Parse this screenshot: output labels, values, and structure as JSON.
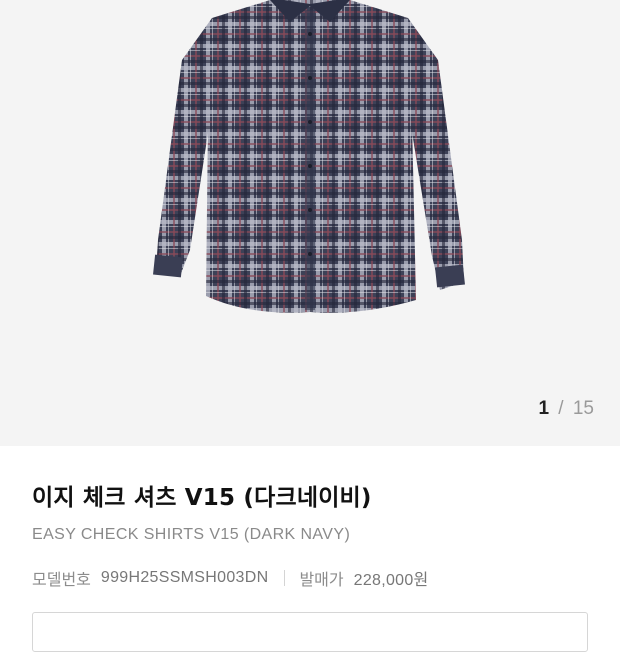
{
  "gallery": {
    "image_alt": "plaid check shirt dark navy",
    "colors": {
      "base": "#3b3f55",
      "check_light": "#c9ccd6",
      "check_red": "#8a4a55"
    },
    "pager": {
      "current": "1",
      "separator": "/",
      "total": "15"
    }
  },
  "product": {
    "title_ko": "이지 체크 셔츠 V15 (다크네이비)",
    "title_en": "EASY CHECK SHIRTS V15 (DARK NAVY)",
    "model_label": "모델번호",
    "model_value": "999H25SSMSH003DN",
    "price_label": "발매가",
    "price_value": "228,000원"
  }
}
